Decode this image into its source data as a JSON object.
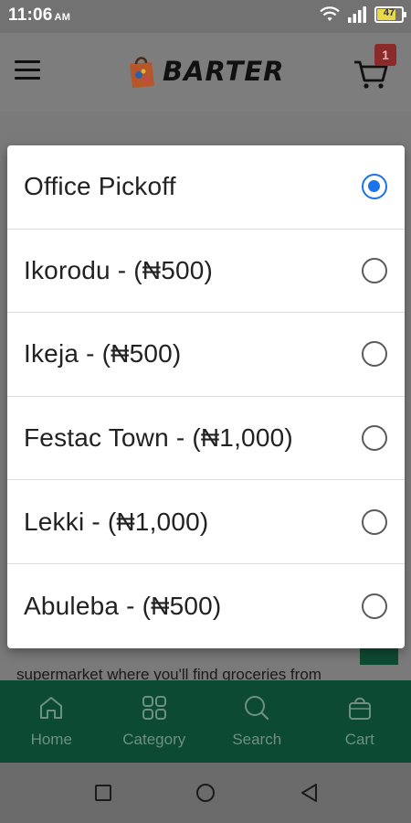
{
  "status_bar": {
    "time": "11:06",
    "ampm": "AM",
    "battery": "47",
    "icons": [
      "wifi-icon",
      "signal-icon",
      "battery-icon"
    ]
  },
  "header": {
    "logo_text": "BARTER",
    "cart_count": "1"
  },
  "background": {
    "text": "supermarket where you'll find groceries from"
  },
  "bottom_nav": {
    "items": [
      {
        "label": "Home",
        "icon": "home-icon"
      },
      {
        "label": "Category",
        "icon": "grid-icon"
      },
      {
        "label": "Search",
        "icon": "search-icon"
      },
      {
        "label": "Cart",
        "icon": "bag-icon"
      }
    ]
  },
  "dialog": {
    "selected_index": 0,
    "options": [
      {
        "label": "Office Pickoff"
      },
      {
        "label": "Ikorodu - (₦500)"
      },
      {
        "label": "Ikeja - (₦500)"
      },
      {
        "label": "Festac Town - (₦1,000)"
      },
      {
        "label": "Lekki - (₦1,000)"
      },
      {
        "label": "Abuleba - (₦500)"
      }
    ]
  },
  "colors": {
    "accent": "#1a73e8",
    "nav_green": "#0c4a33",
    "badge": "#8a2a2a"
  }
}
